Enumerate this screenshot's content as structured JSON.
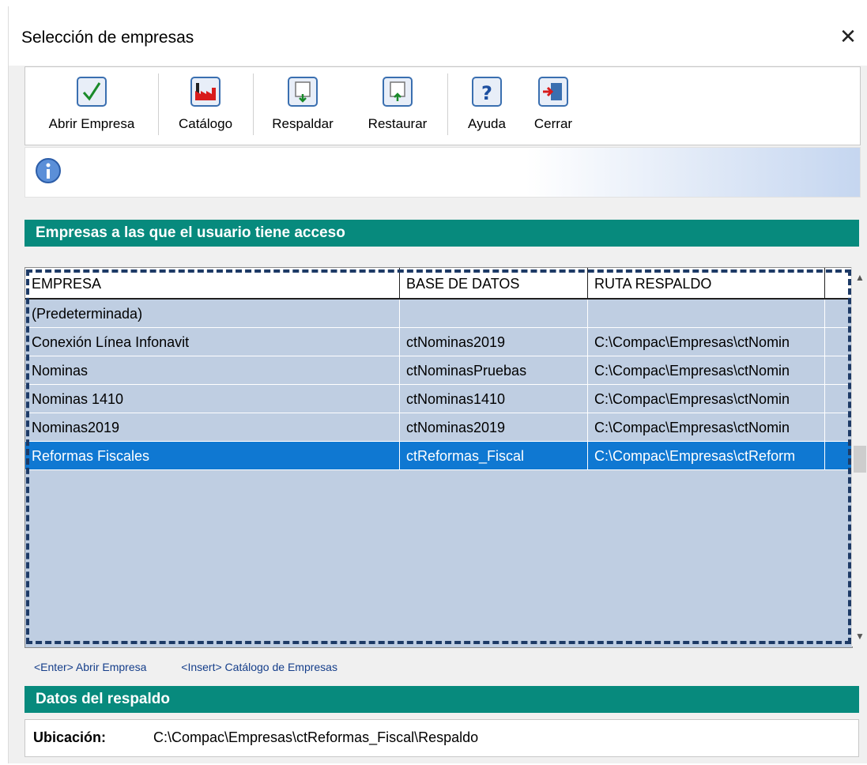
{
  "window": {
    "title": "Selección de empresas",
    "close_symbol": "✕"
  },
  "toolbar": {
    "buttons": [
      {
        "label": "Abrir Empresa",
        "icon": "checkmark-icon"
      },
      {
        "label": "Catálogo",
        "icon": "factory-icon"
      },
      {
        "label": "Respaldar",
        "icon": "backup-icon"
      },
      {
        "label": "Restaurar",
        "icon": "restore-icon"
      },
      {
        "label": "Ayuda",
        "icon": "help-icon"
      },
      {
        "label": "Cerrar",
        "icon": "exit-icon"
      }
    ]
  },
  "info_bar": {
    "icon": "info-icon",
    "message": ""
  },
  "companies": {
    "heading": "Empresas a las que el usuario tiene acceso",
    "columns": [
      "EMPRESA",
      "BASE DE DATOS",
      "RUTA RESPALDO"
    ],
    "rows": [
      [
        "(Predeterminada)",
        "",
        ""
      ],
      [
        "Conexión Línea Infonavit",
        "ctNominas2019",
        "C:\\Compac\\Empresas\\ctNomin"
      ],
      [
        "Nominas",
        "ctNominasPruebas",
        "C:\\Compac\\Empresas\\ctNomin"
      ],
      [
        "Nominas 1410",
        "ctNominas1410",
        "C:\\Compac\\Empresas\\ctNomin"
      ],
      [
        "Nominas2019",
        "ctNominas2019",
        "C:\\Compac\\Empresas\\ctNomin"
      ],
      [
        "Reformas Fiscales",
        "ctReformas_Fiscal",
        "C:\\Compac\\Empresas\\ctReform"
      ]
    ],
    "selected_row": 5
  },
  "hints": {
    "enter": "<Enter> Abrir Empresa",
    "insert": "<Insert> Catálogo de Empresas"
  },
  "backup": {
    "heading": "Datos del respaldo",
    "location_label": "Ubicación:",
    "location_value": "C:\\Compac\\Empresas\\ctReformas_Fiscal\\Respaldo"
  },
  "colors": {
    "section_header": "#078a7d",
    "grid_bg": "#bfcee2",
    "selection": "#0f78d2",
    "focus_border": "#1d3a66"
  }
}
